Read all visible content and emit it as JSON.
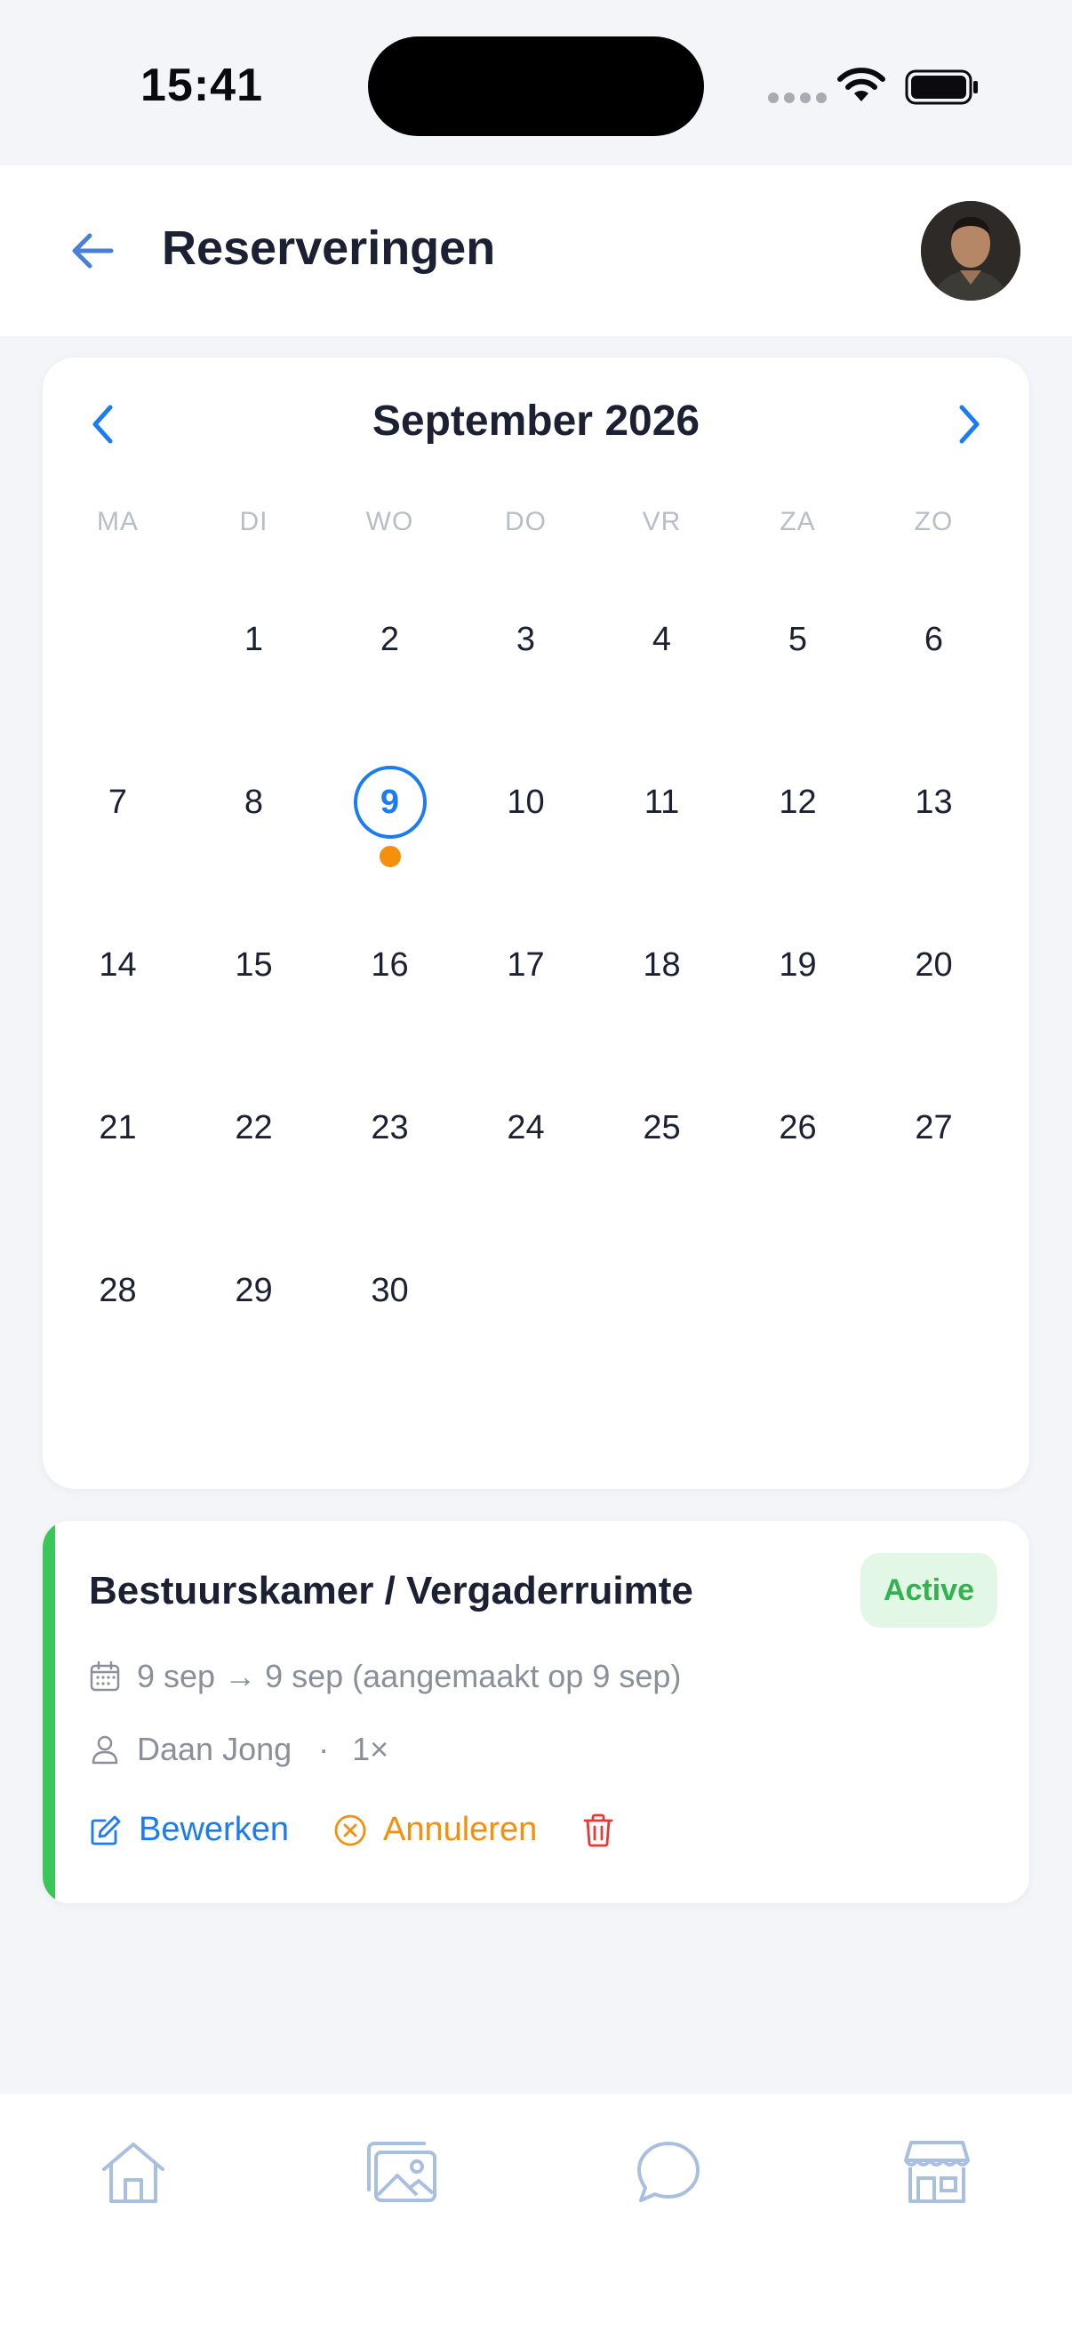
{
  "status_bar": {
    "time": "15:41"
  },
  "header": {
    "title": "Reserveringen"
  },
  "calendar": {
    "month_title": "September 2026",
    "weekdays": [
      "MA",
      "DI",
      "WO",
      "DO",
      "VR",
      "ZA",
      "ZO"
    ],
    "weeks": [
      [
        "",
        "1",
        "2",
        "3",
        "4",
        "5",
        "6"
      ],
      [
        "7",
        "8",
        "9",
        "10",
        "11",
        "12",
        "13"
      ],
      [
        "14",
        "15",
        "16",
        "17",
        "18",
        "19",
        "20"
      ],
      [
        "21",
        "22",
        "23",
        "24",
        "25",
        "26",
        "27"
      ],
      [
        "28",
        "29",
        "30",
        "",
        "",
        "",
        ""
      ]
    ],
    "selected_day": "9",
    "event_days": [
      "9"
    ]
  },
  "reservation": {
    "title": "Bestuurskamer / Vergaderruimte",
    "status": "Active",
    "dates": "9 sep → 9 sep (aangemaakt op 9 sep)",
    "user": "Daan Jong",
    "count": "1×",
    "edit_label": "Bewerken",
    "cancel_label": "Annuleren"
  },
  "colors": {
    "accent_blue": "#1a7cf0",
    "event_orange": "#f5900c",
    "status_green": "#3cc65a",
    "delete_red": "#e53935"
  },
  "nav": {
    "items": [
      "home-icon",
      "gallery-icon",
      "chat-icon",
      "store-icon"
    ]
  }
}
